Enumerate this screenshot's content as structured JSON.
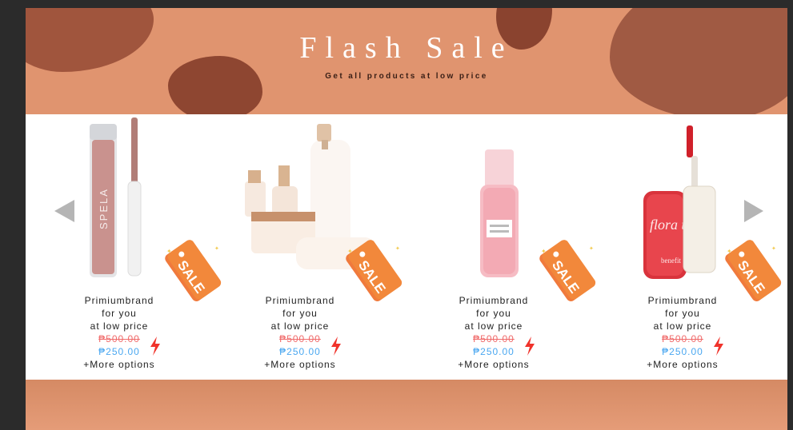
{
  "banner": {
    "title": "Flash Sale",
    "subtitle": "Get all products at low price"
  },
  "colors": {
    "banner_bg": "#e0946f",
    "blob": "#9b5139",
    "old_price": "#f06b6b",
    "new_price": "#4aa7f0",
    "sale_tag": "#f07a3c"
  },
  "carousel": {
    "prev_icon": "chevron-left-icon",
    "next_icon": "chevron-right-icon",
    "sale_badge_text": "SALE",
    "products": [
      {
        "line1": "Primiumbrand",
        "line2": "for you",
        "line3": "at low price",
        "old_price": "₱500.00",
        "new_price": "₱250.00",
        "more": "+More options",
        "image_label": "SPELA"
      },
      {
        "line1": "Primiumbrand",
        "line2": "for you",
        "line3": "at low price",
        "old_price": "₱500.00",
        "new_price": "₱250.00",
        "more": "+More options"
      },
      {
        "line1": "Primiumbrand",
        "line2": "for you",
        "line3": "at low price",
        "old_price": "₱500.00",
        "new_price": "₱250.00",
        "more": "+More options"
      },
      {
        "line1": "Primiumbrand",
        "line2": "for you",
        "line3": "at low price",
        "old_price": "₱500.00",
        "new_price": "₱250.00",
        "more": "+More options",
        "image_label": "flora tint",
        "image_brand": "benefit"
      }
    ]
  }
}
